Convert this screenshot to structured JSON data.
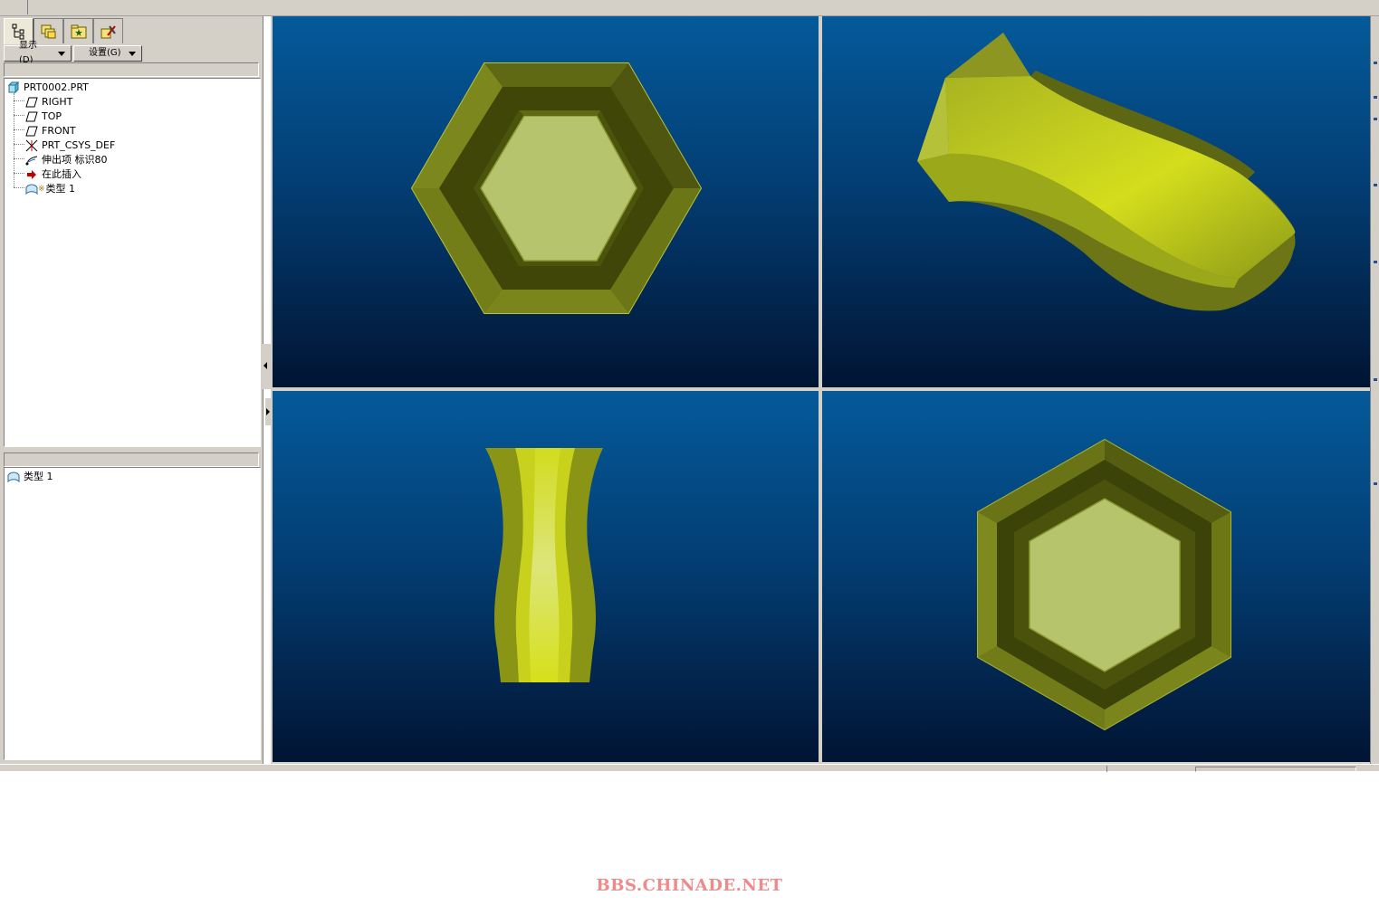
{
  "toolbar": {
    "display_label": "显示(D)",
    "settings_label": "设置(G)"
  },
  "tabs": [
    {
      "name": "model-tree-tab",
      "icon": "model-tree-icon"
    },
    {
      "name": "layers-tab",
      "icon": "layers-icon"
    },
    {
      "name": "favorites-tab",
      "icon": "folder-star-icon"
    },
    {
      "name": "tools-tab",
      "icon": "tools-icon"
    }
  ],
  "model_tree": {
    "root": "PRT0002.PRT",
    "items": [
      {
        "label": "RIGHT",
        "icon": "datum-plane-icon"
      },
      {
        "label": "TOP",
        "icon": "datum-plane-icon"
      },
      {
        "label": "FRONT",
        "icon": "datum-plane-icon"
      },
      {
        "label": "PRT_CSYS_DEF",
        "icon": "coordinate-system-icon"
      },
      {
        "label": "伸出项 标识80",
        "icon": "protrusion-icon"
      },
      {
        "label": "在此插入",
        "icon": "insert-here-arrow-icon"
      },
      {
        "label": "类型 1",
        "icon": "type-feature-icon"
      }
    ]
  },
  "detail_tree": {
    "items": [
      {
        "label": "类型 1",
        "icon": "type-feature-icon"
      }
    ]
  },
  "viewports": [
    {
      "view": "top",
      "shape": "hexagonal-vase-top-view"
    },
    {
      "view": "isometric",
      "shape": "hexagonal-vase-isometric"
    },
    {
      "view": "front",
      "shape": "hexagonal-vase-front-view"
    },
    {
      "view": "bottom",
      "shape": "hexagonal-vase-bottom-view"
    }
  ],
  "colors": {
    "ui_gray": "#d4d0c8",
    "viewport_top": "#045a9a",
    "viewport_bottom": "#011433",
    "model_yellow": "#c8d22a",
    "watermark": "#f08a8a"
  },
  "watermark": "BBS.CHINADE.NET"
}
